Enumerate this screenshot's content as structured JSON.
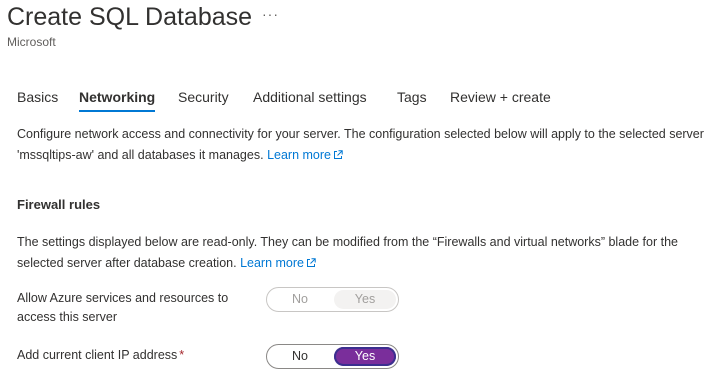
{
  "header": {
    "title": "Create SQL Database",
    "more_label": "···",
    "publisher": "Microsoft"
  },
  "tabs": [
    {
      "label": "Basics",
      "active": false
    },
    {
      "label": "Networking",
      "active": true
    },
    {
      "label": "Security",
      "active": false
    },
    {
      "label": "Additional settings",
      "active": false
    },
    {
      "label": "Tags",
      "active": false
    },
    {
      "label": "Review + create",
      "active": false
    }
  ],
  "intro": {
    "text": "Configure network access and connectivity for your server. The configuration selected below will apply to the selected server 'mssqltips-aw' and all databases it manages.",
    "link": "Learn more"
  },
  "firewall": {
    "heading": "Firewall rules",
    "description": "The settings displayed below are read-only. They can be modified from the “Firewalls and virtual networks” blade for the selected server after database creation.",
    "link": "Learn more",
    "allow_azure": {
      "label": "Allow Azure services and resources to access this server",
      "options": [
        "No",
        "Yes"
      ],
      "selected": "Yes",
      "disabled": true
    },
    "add_client_ip": {
      "label": "Add current client IP address",
      "required_marker": "*",
      "options": [
        "No",
        "Yes"
      ],
      "selected": "Yes",
      "disabled": false
    }
  },
  "icons": {
    "external_link": "external-link-icon",
    "more": "more-options-icon"
  },
  "colors": {
    "accent": "#0078d4",
    "toggle_selected": "#7a2e9b",
    "required": "#a4262c"
  }
}
